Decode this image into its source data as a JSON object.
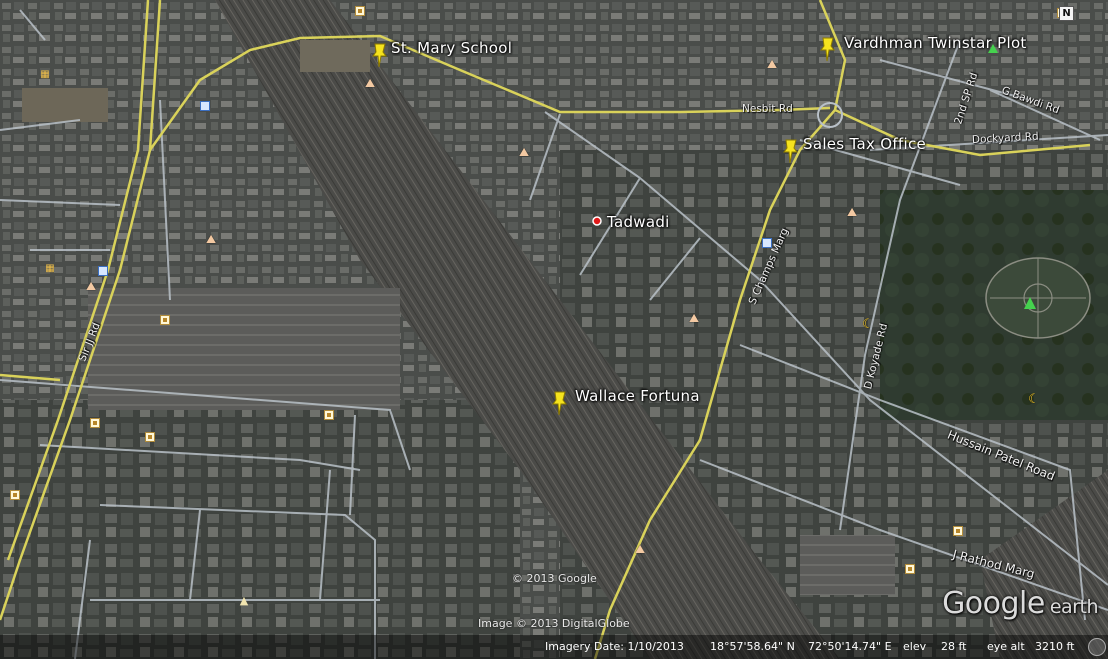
{
  "placemarks": {
    "st_mary": "St. Mary School",
    "vardhman": "Vardhman Twinstar Plot",
    "sales_tax": "Sales Tax Office",
    "tadwadi": "Tadwadi",
    "wallace": "Wallace Fortuna"
  },
  "roads": {
    "sir_jj": "Sir JJ Rd",
    "nesbit": "Nesbit Rd",
    "dockyard": "Dockyard Rd",
    "g_bawdi": "G Bawdi Rd",
    "second_sp": "2nd SP Rd",
    "s_champs": "S Champs Marg",
    "d_koyade": "D Koyade Rd",
    "hussain_patel": "Hussain Patel Road",
    "j_rathod": "J Rathod Marg"
  },
  "credits": {
    "copyright_google": "© 2013 Google",
    "copyright_image": "Image © 2013 DigitalGlobe",
    "logo_main": "Google",
    "logo_sub": "earth"
  },
  "status": {
    "imagery_date": "Imagery Date: 1/10/2013",
    "lat": "18°57'58.64\" N",
    "lon": "72°50'14.74\" E",
    "elev_label": "elev",
    "elev_value": "28 ft",
    "eye_alt_label": "eye alt",
    "eye_alt_value": "3210 ft"
  },
  "compass": {
    "label": "N"
  },
  "colors": {
    "pin": "#f5e31e",
    "road_major": "#d9d25a",
    "road_minor": "#b9c1c8",
    "dot": "#e01a1a"
  },
  "icons": {
    "pin": "yellow-pushpin-icon",
    "dot": "red-dot-icon",
    "hike": "hiking-icon",
    "mosque": "crescent-icon",
    "park": "tree-icon",
    "shop": "square-poi-icon"
  }
}
